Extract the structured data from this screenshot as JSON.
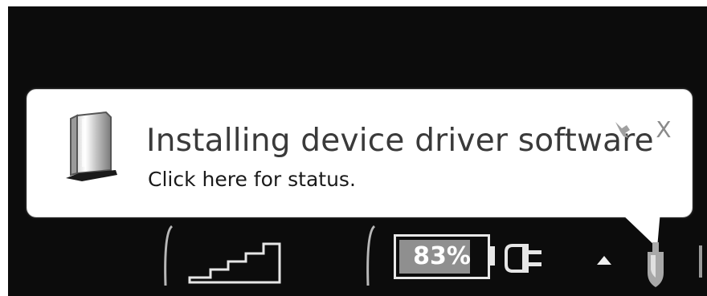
{
  "notification": {
    "title": "Installing device driver software",
    "subtitle": "Click here for status.",
    "icon": "external-drive-icon",
    "options_icon": "wrench-icon",
    "close_label": "X"
  },
  "tray": {
    "network_icon": "signal-strength-icon",
    "battery": {
      "label": "83%",
      "level_percent": 83
    },
    "power_icon": "plug-icon",
    "overflow_icon": "chevron-up-icon",
    "device_icon": "usb-device-icon"
  }
}
